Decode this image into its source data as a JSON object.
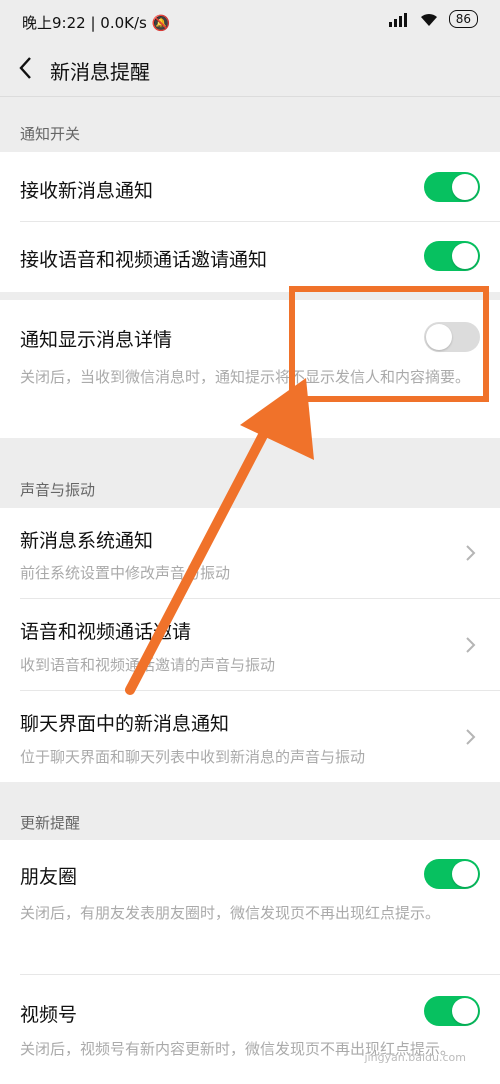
{
  "status": {
    "time": "晚上9:22",
    "speed": "0.0K/s",
    "battery": "86"
  },
  "nav": {
    "title": "新消息提醒"
  },
  "sections": {
    "notify": "通知开关",
    "sound": "声音与振动",
    "update": "更新提醒"
  },
  "rows": {
    "receive_new": {
      "title": "接收新消息通知",
      "state": "on"
    },
    "receive_call": {
      "title": "接收语音和视频通话邀请通知",
      "state": "on"
    },
    "show_detail": {
      "title": "通知显示消息详情",
      "desc": "关闭后，当收到微信消息时，通知提示将不显示发信人和内容摘要。",
      "state": "off"
    },
    "system_notify": {
      "title": "新消息系统通知",
      "desc": "前往系统设置中修改声音与振动"
    },
    "call_invite": {
      "title": "语音和视频通话邀请",
      "desc": "收到语音和视频通话邀请的声音与振动"
    },
    "chat_notify": {
      "title": "聊天界面中的新消息通知",
      "desc": "位于聊天界面和聊天列表中收到新消息的声音与振动"
    },
    "moments": {
      "title": "朋友圈",
      "desc": "关闭后，有朋友发表朋友圈时，微信发现页不再出现红点提示。",
      "state": "on"
    },
    "channels": {
      "title": "视频号",
      "desc": "关闭后，视频号有新内容更新时，微信发现页不再出现红点提示。",
      "state": "on"
    }
  },
  "watermark": "jingyan.baidu.com",
  "colors": {
    "accent": "#07c160",
    "annotation": "#f0722a"
  }
}
